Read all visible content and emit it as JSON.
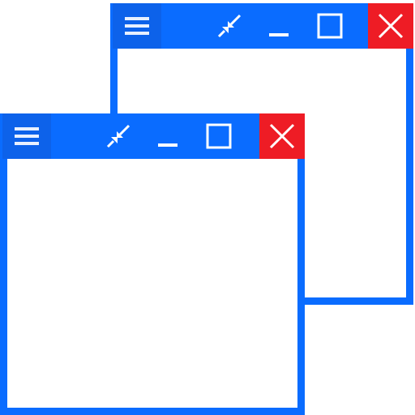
{
  "icons": {
    "menu": "hamburger-menu-icon",
    "restore": "restore-arrows-icon",
    "minimize": "minimize-icon",
    "maximize": "maximize-square-icon",
    "close": "close-x-icon"
  },
  "colors": {
    "frame": "#0a6cff",
    "menu_button": "#0d62ea",
    "close_button": "#ee1c25",
    "glyph": "#ffffff",
    "content": "#ffffff"
  },
  "windows": [
    {
      "id": "back",
      "state": "inactive"
    },
    {
      "id": "front",
      "state": "active"
    }
  ]
}
